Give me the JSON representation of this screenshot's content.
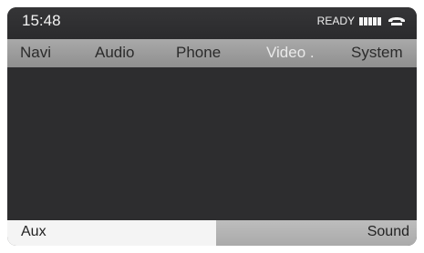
{
  "status": {
    "time": "15:48",
    "ready": "READY"
  },
  "menu": {
    "items": [
      {
        "label": "Navi"
      },
      {
        "label": "Audio"
      },
      {
        "label": "Phone"
      },
      {
        "label": "Video ."
      },
      {
        "label": "System"
      }
    ]
  },
  "bottom": {
    "left_label": "Aux",
    "right_label": "Sound"
  }
}
